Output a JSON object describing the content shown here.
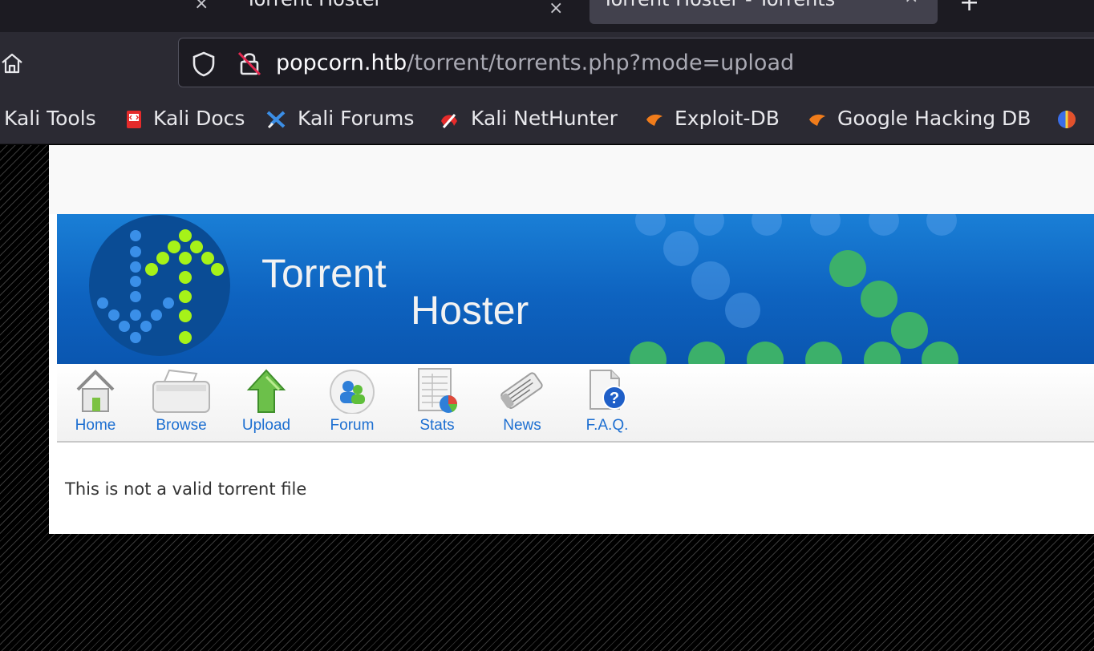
{
  "browser": {
    "tabs": [
      {
        "title": "Torrent Hoster"
      },
      {
        "title": "Torrent Hoster - Torrents"
      }
    ],
    "close_glyph": "×",
    "new_tab_glyph": "+",
    "url_host": "popcorn.htb",
    "url_path": "/torrent/torrents.php?mode=upload",
    "bookmarks": [
      {
        "label": "Kali Tools",
        "icon": "kali-tools-icon"
      },
      {
        "label": "Kali Docs",
        "icon": "kali-docs-icon"
      },
      {
        "label": "Kali Forums",
        "icon": "kali-forums-icon"
      },
      {
        "label": "Kali NetHunter",
        "icon": "kali-nethunter-icon"
      },
      {
        "label": "Exploit-DB",
        "icon": "exploit-db-icon"
      },
      {
        "label": "Google Hacking DB",
        "icon": "google-hacking-db-icon"
      }
    ]
  },
  "site": {
    "title_line1": "Torrent",
    "title_line2": "Hoster",
    "menu": [
      {
        "label": "Home",
        "icon": "home-icon"
      },
      {
        "label": "Browse",
        "icon": "browse-icon"
      },
      {
        "label": "Upload",
        "icon": "upload-icon"
      },
      {
        "label": "Forum",
        "icon": "forum-icon"
      },
      {
        "label": "Stats",
        "icon": "stats-icon"
      },
      {
        "label": "News",
        "icon": "news-icon"
      },
      {
        "label": "F.A.Q.",
        "icon": "faq-icon"
      }
    ],
    "message": "This is not a valid torrent file"
  },
  "colors": {
    "chrome_dark": "#1c1b22",
    "chrome_toolbar": "#2b2a33",
    "banner_blue": "#0e63c0",
    "menu_link": "#1d6fd1",
    "logo_green": "#a6f219"
  }
}
